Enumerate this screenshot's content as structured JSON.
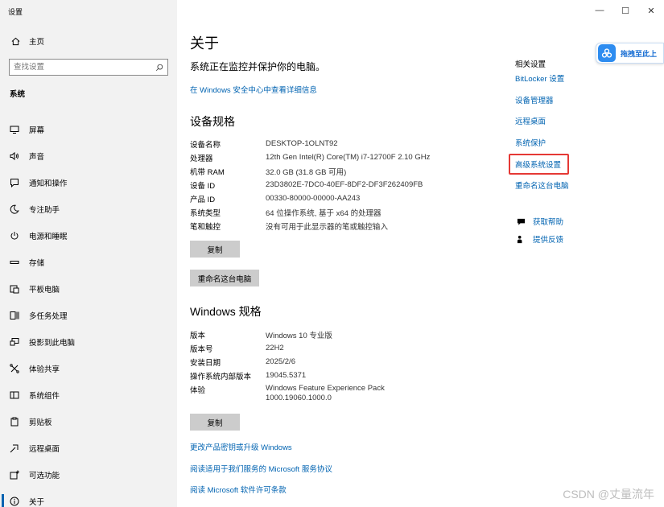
{
  "window": {
    "title": "设置",
    "controls": [
      "—",
      "☐",
      "✕"
    ]
  },
  "sidebar": {
    "home_label": "主页",
    "search_placeholder": "查找设置",
    "section": "系统",
    "items": [
      {
        "label": "屏幕",
        "icon": "display-icon"
      },
      {
        "label": "声音",
        "icon": "speaker-icon"
      },
      {
        "label": "通知和操作",
        "icon": "notification-icon"
      },
      {
        "label": "专注助手",
        "icon": "moon-icon"
      },
      {
        "label": "电源和睡眠",
        "icon": "power-icon"
      },
      {
        "label": "存储",
        "icon": "storage-icon"
      },
      {
        "label": "平板电脑",
        "icon": "tablet-icon"
      },
      {
        "label": "多任务处理",
        "icon": "multitask-icon"
      },
      {
        "label": "投影到此电脑",
        "icon": "project-icon"
      },
      {
        "label": "体验共享",
        "icon": "share-icon"
      },
      {
        "label": "系统组件",
        "icon": "components-icon"
      },
      {
        "label": "剪贴板",
        "icon": "clipboard-icon"
      },
      {
        "label": "远程桌面",
        "icon": "remote-icon"
      },
      {
        "label": "可选功能",
        "icon": "optional-features-icon"
      },
      {
        "label": "关于",
        "icon": "info-icon",
        "active": true
      }
    ]
  },
  "main": {
    "title": "关于",
    "protect_text": "系统正在监控并保护你的电脑。",
    "security_link": "在 Windows 安全中心中查看详细信息",
    "device_specs": {
      "heading": "设备规格",
      "rows": [
        {
          "k": "设备名称",
          "v": "DESKTOP-1OLNT92"
        },
        {
          "k": "处理器",
          "v": "12th Gen Intel(R) Core(TM) i7-12700F   2.10 GHz"
        },
        {
          "k": "机带 RAM",
          "v": "32.0 GB (31.8 GB 可用)"
        },
        {
          "k": "设备 ID",
          "v": "23D3802E-7DC0-40EF-8DF2-DF3F262409FB"
        },
        {
          "k": "产品 ID",
          "v": "00330-80000-00000-AA243"
        },
        {
          "k": "系统类型",
          "v": "64 位操作系统, 基于 x64 的处理器"
        },
        {
          "k": "笔和触控",
          "v": "没有可用于此显示器的笔或触控输入"
        }
      ],
      "copy_button": "复制",
      "rename_button": "重命名这台电脑"
    },
    "windows_specs": {
      "heading": "Windows 规格",
      "rows": [
        {
          "k": "版本",
          "v": "Windows 10 专业版"
        },
        {
          "k": "版本号",
          "v": "22H2"
        },
        {
          "k": "安装日期",
          "v": "2025/2/6"
        },
        {
          "k": "操作系统内部版本",
          "v": "19045.5371"
        },
        {
          "k": "体验",
          "v": "Windows Feature Experience Pack",
          "v2": "1000.19060.1000.0"
        }
      ],
      "copy_button": "复制"
    },
    "links": [
      "更改产品密钥或升级 Windows",
      "阅读适用于我们服务的 Microsoft 服务协议",
      "阅读 Microsoft 软件许可条款"
    ]
  },
  "related": {
    "title": "相关设置",
    "links": [
      "BitLocker 设置",
      "设备管理器",
      "远程桌面",
      "系统保护",
      "高级系统设置",
      "重命名这台电脑"
    ],
    "highlighted": "高级系统设置",
    "highlight_color": "#e53935",
    "help": {
      "label": "获取帮助",
      "icon": "help-chat-icon"
    },
    "feedback": {
      "label": "提供反馈",
      "icon": "feedback-icon"
    }
  },
  "overlay": {
    "text": "拖拽至此上"
  },
  "watermark": "CSDN @丈量流年",
  "colors": {
    "accent": "#0063b1",
    "sidebar_bg": "#f2f2f2",
    "button_bg": "#cccccc"
  }
}
